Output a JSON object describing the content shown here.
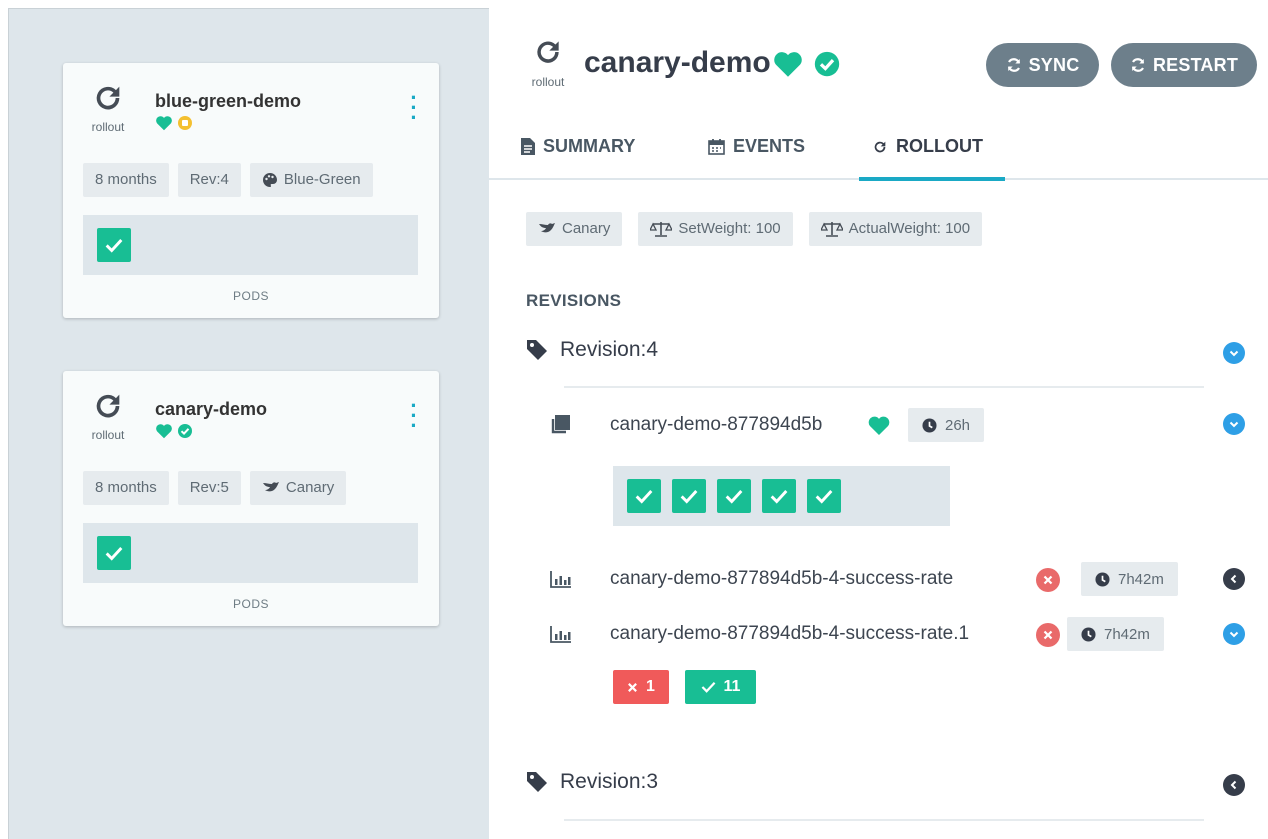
{
  "sidebar": {
    "cards": [
      {
        "kind_label": "rollout",
        "title": "blue-green-demo",
        "tags": [
          "8 months",
          "Rev:4",
          "Blue-Green"
        ],
        "strategy_icon": "palette-icon",
        "pods_label": "PODS"
      },
      {
        "kind_label": "rollout",
        "title": "canary-demo",
        "tags": [
          "8 months",
          "Rev:5",
          "Canary"
        ],
        "strategy_icon": "canary-bird-icon",
        "pods_label": "PODS"
      }
    ]
  },
  "header": {
    "kind_label": "rollout",
    "title": "canary-demo",
    "sync_label": "SYNC",
    "restart_label": "RESTART"
  },
  "tabs": [
    {
      "label": "SUMMARY",
      "icon": "file-icon"
    },
    {
      "label": "EVENTS",
      "icon": "calendar-icon"
    },
    {
      "label": "ROLLOUT",
      "icon": "rollout-icon",
      "active": true
    }
  ],
  "rollout": {
    "chips": [
      "Canary",
      "SetWeight: 100",
      "ActualWeight: 100"
    ],
    "revisions_label": "REVISIONS",
    "revisions": [
      {
        "title": "Revision:4",
        "replicaset": {
          "name": "canary-demo-877894d5b",
          "age": "26h",
          "pods_ok": 5
        },
        "analysis": [
          {
            "name": "canary-demo-877894d5b-4-success-rate",
            "age": "7h42m",
            "status": "error"
          },
          {
            "name": "canary-demo-877894d5b-4-success-rate.1",
            "age": "7h42m",
            "status": "error"
          }
        ],
        "counts": {
          "failed": "1",
          "passed": "11"
        }
      },
      {
        "title": "Revision:3"
      }
    ]
  },
  "colors": {
    "green": "#18be94",
    "yellow": "#f4c030",
    "blue": "#2e9fe6",
    "red": "#e96a6a",
    "teal": "#1aa9c5"
  }
}
